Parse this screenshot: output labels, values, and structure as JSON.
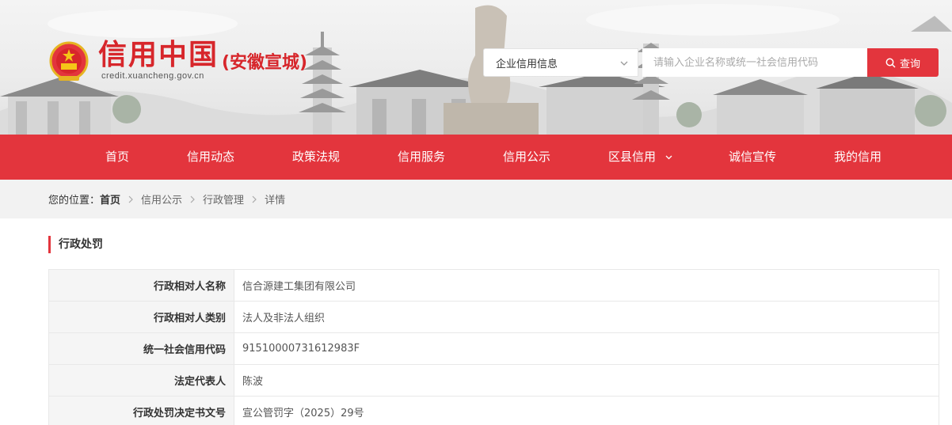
{
  "header": {
    "title": "信用中国",
    "region": "(安徽宣城)",
    "domain": "credit.xuancheng.gov.cn",
    "search": {
      "category": "企业信用信息",
      "placeholder": "请输入企业名称或统一社会信用代码",
      "button_label": "查询"
    }
  },
  "nav": {
    "items": [
      {
        "label": "首页"
      },
      {
        "label": "信用动态"
      },
      {
        "label": "政策法规"
      },
      {
        "label": "信用服务"
      },
      {
        "label": "信用公示"
      },
      {
        "label": "区县信用",
        "has_dropdown": true
      },
      {
        "label": "诚信宣传"
      },
      {
        "label": "我的信用"
      }
    ]
  },
  "breadcrumb": {
    "prefix": "您的位置：",
    "items": [
      "首页",
      "信用公示",
      "行政管理",
      "详情"
    ]
  },
  "section": {
    "title": "行政处罚"
  },
  "details": {
    "rows": [
      {
        "label": "行政相对人名称",
        "value": "信合源建工集团有限公司"
      },
      {
        "label": "行政相对人类别",
        "value": "法人及非法人组织"
      },
      {
        "label": "统一社会信用代码",
        "value": "91510000731612983F"
      },
      {
        "label": "法定代表人",
        "value": "陈波"
      },
      {
        "label": "行政处罚决定书文号",
        "value": "宣公管罚字（2025）29号"
      }
    ]
  },
  "colors": {
    "brand_red": "#e3353d",
    "title_red": "#d7262b"
  }
}
